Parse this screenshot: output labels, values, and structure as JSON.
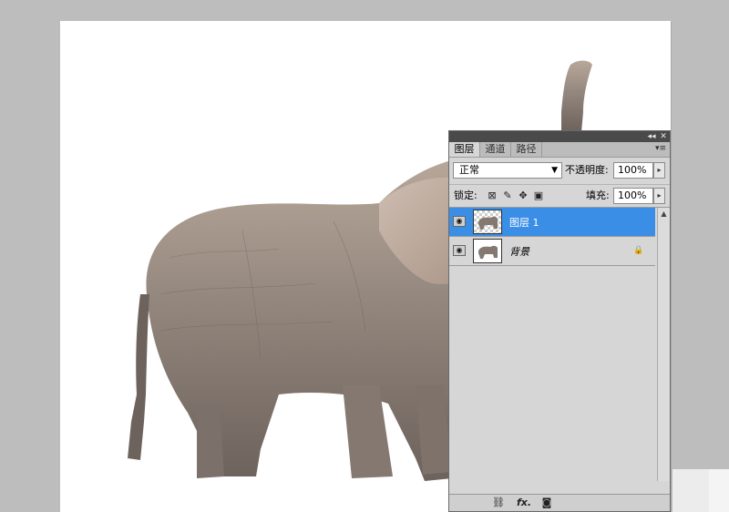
{
  "layers_panel": {
    "tabs": [
      "图层",
      "通道",
      "路径"
    ],
    "active_tab": 0,
    "blend_mode": "正常",
    "opacity_label": "不透明度:",
    "opacity_value": "100%",
    "lock_label": "锁定:",
    "fill_label": "填充:",
    "fill_value": "100%",
    "layers": [
      {
        "name": "图层 1",
        "selected": true
      },
      {
        "name": "背景",
        "selected": false,
        "locked": true
      }
    ]
  },
  "icons": {
    "collapse": "double-chevron-left-icon",
    "close": "close-icon",
    "menu": "panel-menu-icon",
    "link": "link-icon",
    "fx": "fx-icon",
    "mask": "mask-icon"
  },
  "colors": {
    "selected_layer": "#3a8ee6",
    "panel_bg": "#d6d6d6",
    "workspace_bg": "#bdbdbd"
  }
}
